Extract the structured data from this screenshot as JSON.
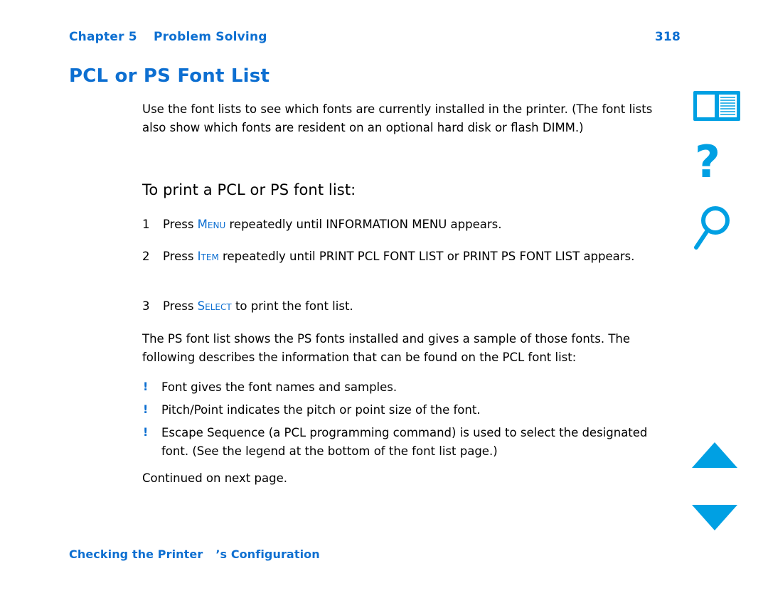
{
  "header": {
    "chapter": "Chapter 5",
    "chapter_title": "Problem Solving",
    "page_number": "318",
    "link_color": "#0d6fd1"
  },
  "title": "PCL or PS Font List",
  "intro": "Use the font lists to see which fonts are currently installed in the printer. (The font lists also show which fonts are resident on an optional hard disk or flash DIMM.)",
  "section_heading": "To print a PCL or PS font list:",
  "steps": [
    {
      "number": "1",
      "pre": "Press ",
      "key": "Menu",
      "post": " repeatedly until INFORMATION MENU appears."
    },
    {
      "number": "2",
      "pre": "Press ",
      "key": "Item",
      "post": " repeatedly until PRINT PCL FONT LIST or PRINT PS FONT LIST appears."
    },
    {
      "number": "3",
      "pre": "Press ",
      "key": "Select",
      "post": " to print the font list."
    }
  ],
  "paragraph": "The PS font list shows the PS fonts installed and gives a sample of those fonts. The following describes the information that can be found on the PCL font list:",
  "bullets": [
    {
      "mark": "!",
      "text": "Font gives the font names and samples."
    },
    {
      "mark": "!",
      "text": "Pitch/Point indicates the pitch or point size of the font."
    },
    {
      "mark": "!",
      "text": "Escape Sequence (a PCL programming command) is used to select the designated font. (See the legend at the bottom of the font list page.)"
    }
  ],
  "continued": "Continued on next page.",
  "footer": {
    "text_1": "Checking the Printer",
    "text_2": "’s Configuration"
  },
  "rail": {
    "book_icon": "book-icon",
    "help_icon": "?",
    "search_icon": "magnifier-icon",
    "up_icon": "triangle-up-icon",
    "down_icon": "triangle-down-icon",
    "icon_color": "#00a0e3"
  }
}
